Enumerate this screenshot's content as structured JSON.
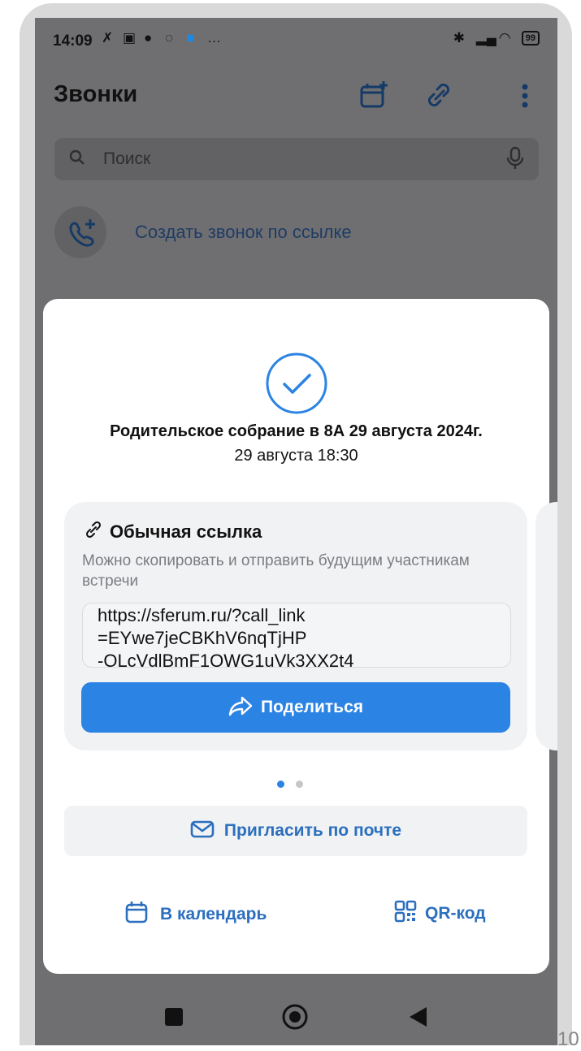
{
  "status_bar": {
    "time": "14:09",
    "battery": "99"
  },
  "app_bar": {
    "title": "Звонки",
    "calendar_add_icon": "calendar-plus-icon",
    "link_icon": "link-icon",
    "more_icon": "more-vertical-icon"
  },
  "search": {
    "placeholder": "Поиск"
  },
  "create_call": {
    "label": "Создать звонок по ссылке"
  },
  "sheet": {
    "meeting_title": "Родительское собрание в 8А 29 августа 2024г.",
    "meeting_time": "29 августа 18:30",
    "link_card": {
      "title": "Обычная ссылка",
      "description": "Можно скопировать и отправить будущим участникам встречи",
      "link_lines": [
        "https://sferum.ru/?call_link",
        "=EYwe7jeCBKhV6nqTjHP",
        "-OLcVdlBmF1QWG1uVk3XX2t4"
      ],
      "share_label": "Поделиться"
    },
    "pager": {
      "count": 2,
      "active": 1
    },
    "invite_label": "Пригласить по почте",
    "calendar_label": "В календарь",
    "qr_label": "QR-код"
  },
  "colors": {
    "accent": "#2b83e4",
    "accent_text": "#2b6fbe",
    "overlay": "#6f6f71"
  },
  "page_number": "10"
}
